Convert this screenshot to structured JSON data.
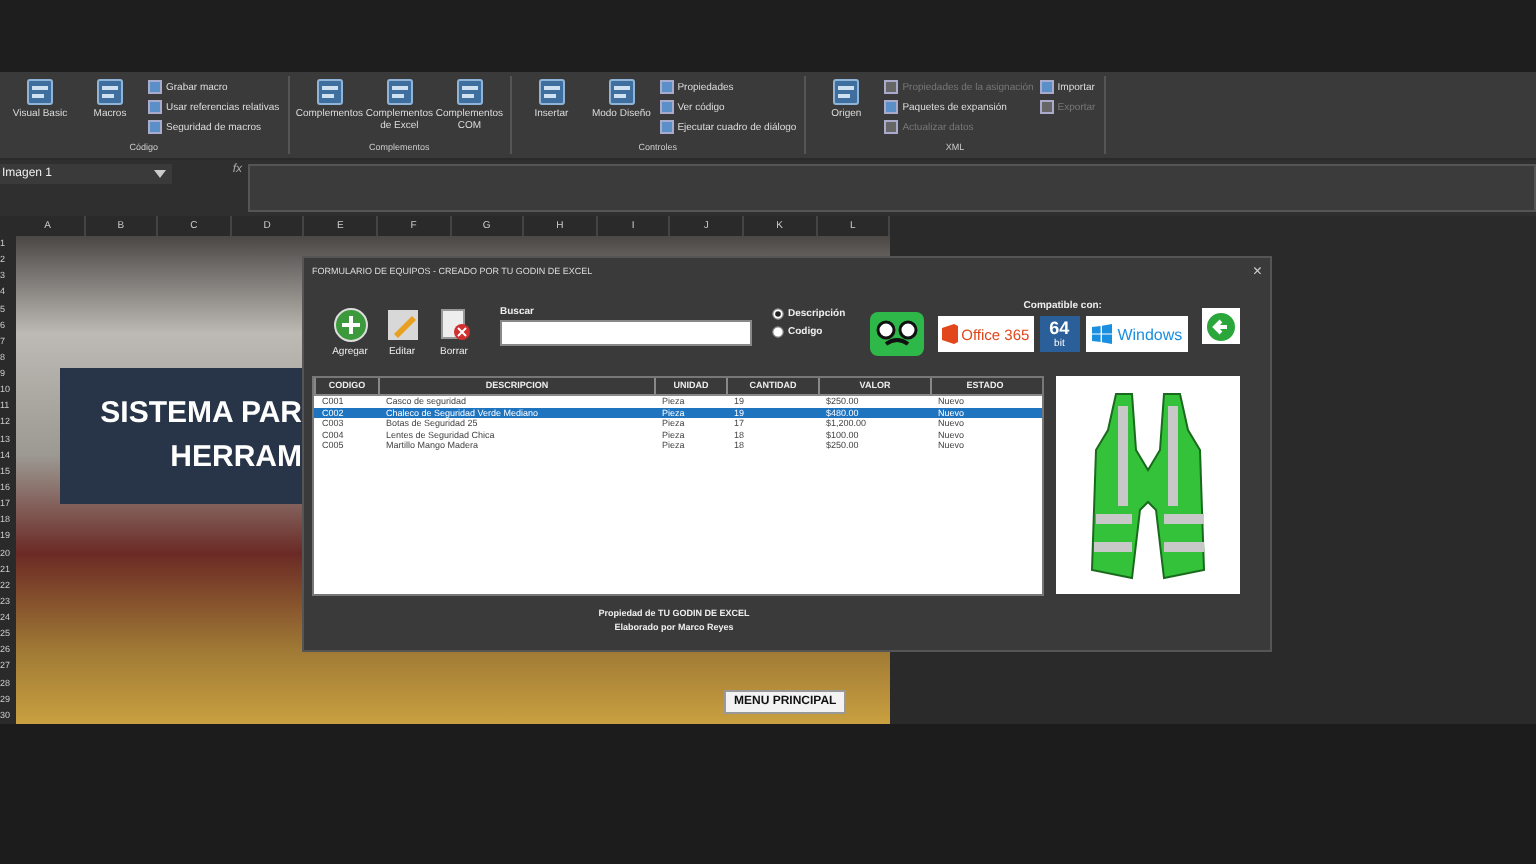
{
  "ribbon": {
    "groups": [
      {
        "label": "Código",
        "columns": [
          [
            {
              "kind": "large",
              "label": "Visual Basic",
              "disabled": false
            }
          ],
          [
            {
              "kind": "large",
              "label": "Macros",
              "disabled": false
            }
          ],
          [
            {
              "kind": "small",
              "label": "Grabar macro",
              "disabled": false
            },
            {
              "kind": "small",
              "label": "Usar referencias relativas",
              "disabled": false
            },
            {
              "kind": "small",
              "label": "Seguridad de macros",
              "disabled": false
            }
          ]
        ]
      },
      {
        "label": "Complementos",
        "columns": [
          [
            {
              "kind": "large",
              "label": "Complementos",
              "disabled": false
            }
          ],
          [
            {
              "kind": "large",
              "label": "Complementos de Excel",
              "disabled": false
            }
          ],
          [
            {
              "kind": "large",
              "label": "Complementos COM",
              "disabled": false
            }
          ]
        ]
      },
      {
        "label": "Controles",
        "columns": [
          [
            {
              "kind": "large",
              "label": "Insertar",
              "disabled": false
            }
          ],
          [
            {
              "kind": "large",
              "label": "Modo Diseño",
              "disabled": false
            }
          ],
          [
            {
              "kind": "small",
              "label": "Propiedades",
              "disabled": false
            },
            {
              "kind": "small",
              "label": "Ver código",
              "disabled": false
            },
            {
              "kind": "small",
              "label": "Ejecutar cuadro de diálogo",
              "disabled": false
            }
          ]
        ]
      },
      {
        "label": "XML",
        "columns": [
          [
            {
              "kind": "large",
              "label": "Origen",
              "disabled": false
            }
          ],
          [
            {
              "kind": "small",
              "label": "Propiedades de la asignación",
              "disabled": true
            },
            {
              "kind": "small",
              "label": "Paquetes de expansión",
              "disabled": false
            },
            {
              "kind": "small",
              "label": "Actualizar datos",
              "disabled": true
            }
          ],
          [
            {
              "kind": "small",
              "label": "Importar",
              "disabled": false
            },
            {
              "kind": "small",
              "label": "Exportar",
              "disabled": true
            }
          ]
        ]
      }
    ]
  },
  "name_box": "Imagen 1",
  "formula_icon": "fx",
  "columns": [
    "A",
    "B",
    "C",
    "D",
    "E",
    "F",
    "G",
    "H",
    "I",
    "J",
    "K",
    "L"
  ],
  "rows": [
    "1",
    "2",
    "3",
    "4",
    "5",
    "6",
    "7",
    "8",
    "9",
    "10",
    "11",
    "12",
    "13",
    "14",
    "15",
    "16",
    "17",
    "18",
    "19",
    "20",
    "21",
    "22",
    "23",
    "24",
    "25",
    "26",
    "27",
    "28",
    "29",
    "30"
  ],
  "banner": {
    "lines": [
      "SISTEMA PAR",
      "HERRAM"
    ]
  },
  "menu_button": "MENU PRINCIPAL",
  "dialog": {
    "title": "FORMULARIO DE EQUIPOS - CREADO POR TU GODIN DE EXCEL",
    "close": "×",
    "actions": [
      {
        "kind": "add",
        "label": "Agregar"
      },
      {
        "kind": "edit",
        "label": "Editar"
      },
      {
        "kind": "delete",
        "label": "Borrar"
      }
    ],
    "search": {
      "label": "Buscar"
    },
    "search_by": [
      {
        "label": "Descripción",
        "selected": true
      },
      {
        "label": "Codigo",
        "selected": false
      }
    ],
    "compatible": {
      "label": "Compatible con:",
      "office": "Office 365",
      "bits": "64",
      "bits_unit": "bit",
      "windows": "Windows"
    },
    "table": {
      "columns": [
        "CODIGO",
        "DESCRIPCION",
        "UNIDAD",
        "CANTIDAD",
        "VALOR",
        "ESTADO"
      ],
      "rows": [
        {
          "cells": [
            "C001",
            "Casco de seguridad",
            "Pieza",
            "19",
            "$250.00",
            "Nuevo"
          ],
          "selected": false
        },
        {
          "cells": [
            "C002",
            "Chaleco de Seguridad Verde Mediano",
            "Pieza",
            "19",
            "$480.00",
            "Nuevo"
          ],
          "selected": true
        },
        {
          "cells": [
            "C003",
            "Botas de Seguridad 25",
            "Pieza",
            "17",
            "$1,200.00",
            "Nuevo"
          ],
          "selected": false
        },
        {
          "cells": [
            "C004",
            "Lentes de Seguridad Chica",
            "Pieza",
            "18",
            "$100.00",
            "Nuevo"
          ],
          "selected": false
        },
        {
          "cells": [
            "C005",
            "Martillo Mango Madera",
            "Pieza",
            "18",
            "$250.00",
            "Nuevo"
          ],
          "selected": false
        }
      ]
    },
    "footer": [
      "Propiedad de TU GODIN DE EXCEL",
      "Elaborado por Marco Reyes"
    ]
  }
}
